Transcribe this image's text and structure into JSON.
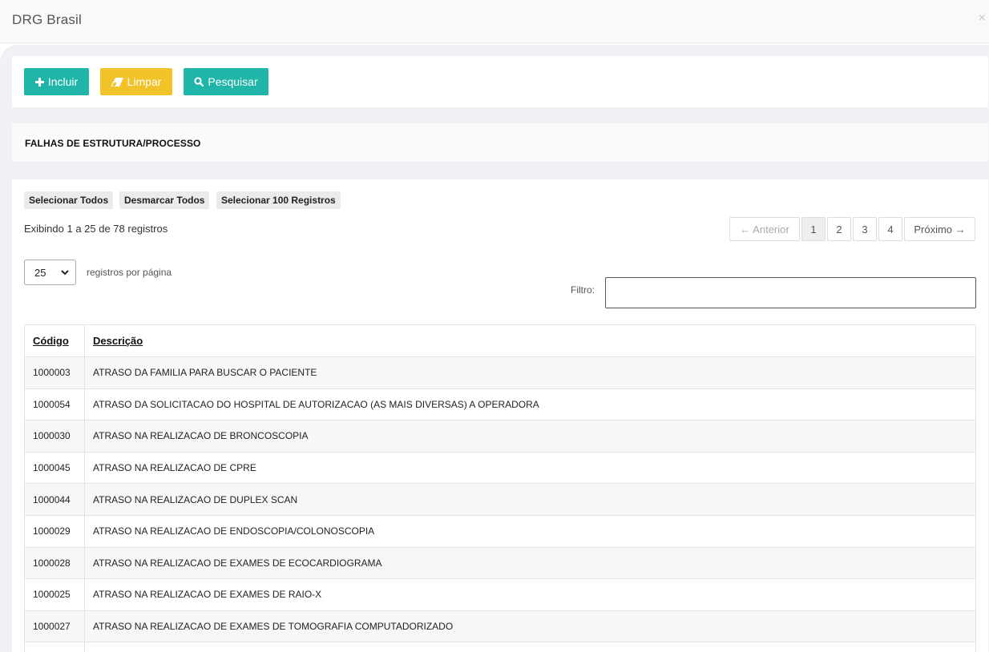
{
  "modal": {
    "title": "DRG Brasil",
    "close_symbol": "×"
  },
  "toolbar": {
    "incluir_label": "Incluir",
    "limpar_label": "Limpar",
    "pesquisar_label": "Pesquisar"
  },
  "section": {
    "title": "FALHAS DE ESTRUTURA/PROCESSO"
  },
  "selection": {
    "select_all": "Selecionar Todos",
    "deselect_all": "Desmarcar Todos",
    "select_100": "Selecionar 100 Registros"
  },
  "info": "Exibindo 1 a 25 de 78 registros",
  "pagination": {
    "previous": "← Anterior",
    "pages": [
      "1",
      "2",
      "3",
      "4"
    ],
    "active_page": "1",
    "next": "Próximo →"
  },
  "length": {
    "selected": "25",
    "label": "registros por página"
  },
  "filter": {
    "label": "Filtro:",
    "value": ""
  },
  "table": {
    "columns": [
      "Código",
      "Descrição"
    ],
    "rows": [
      [
        "1000003",
        "ATRASO DA FAMILIA PARA BUSCAR O PACIENTE"
      ],
      [
        "1000054",
        "ATRASO DA SOLICITACAO DO HOSPITAL DE AUTORIZACAO (AS MAIS DIVERSAS) A OPERADORA"
      ],
      [
        "1000030",
        "ATRASO NA REALIZACAO DE BRONCOSCOPIA"
      ],
      [
        "1000045",
        "ATRASO NA REALIZACAO DE CPRE"
      ],
      [
        "1000044",
        "ATRASO NA REALIZACAO DE DUPLEX SCAN"
      ],
      [
        "1000029",
        "ATRASO NA REALIZACAO DE ENDOSCOPIA/COLONOSCOPIA"
      ],
      [
        "1000028",
        "ATRASO NA REALIZACAO DE EXAMES DE ECOCARDIOGRAMA"
      ],
      [
        "1000025",
        "ATRASO NA REALIZACAO DE EXAMES DE RAIO-X"
      ],
      [
        "1000027",
        "ATRASO NA REALIZACAO DE EXAMES DE TOMOGRAFIA COMPUTADORIZADO"
      ],
      [
        "",
        ""
      ]
    ]
  },
  "colors": {
    "teal": "#1fb5a8",
    "yellow": "#f2c329",
    "body_bg": "#eff1f5"
  },
  "icons": {
    "incluir": "plus-icon",
    "limpar": "eraser-icon",
    "pesquisar": "search-icon",
    "select": "chevron-down-icon"
  }
}
